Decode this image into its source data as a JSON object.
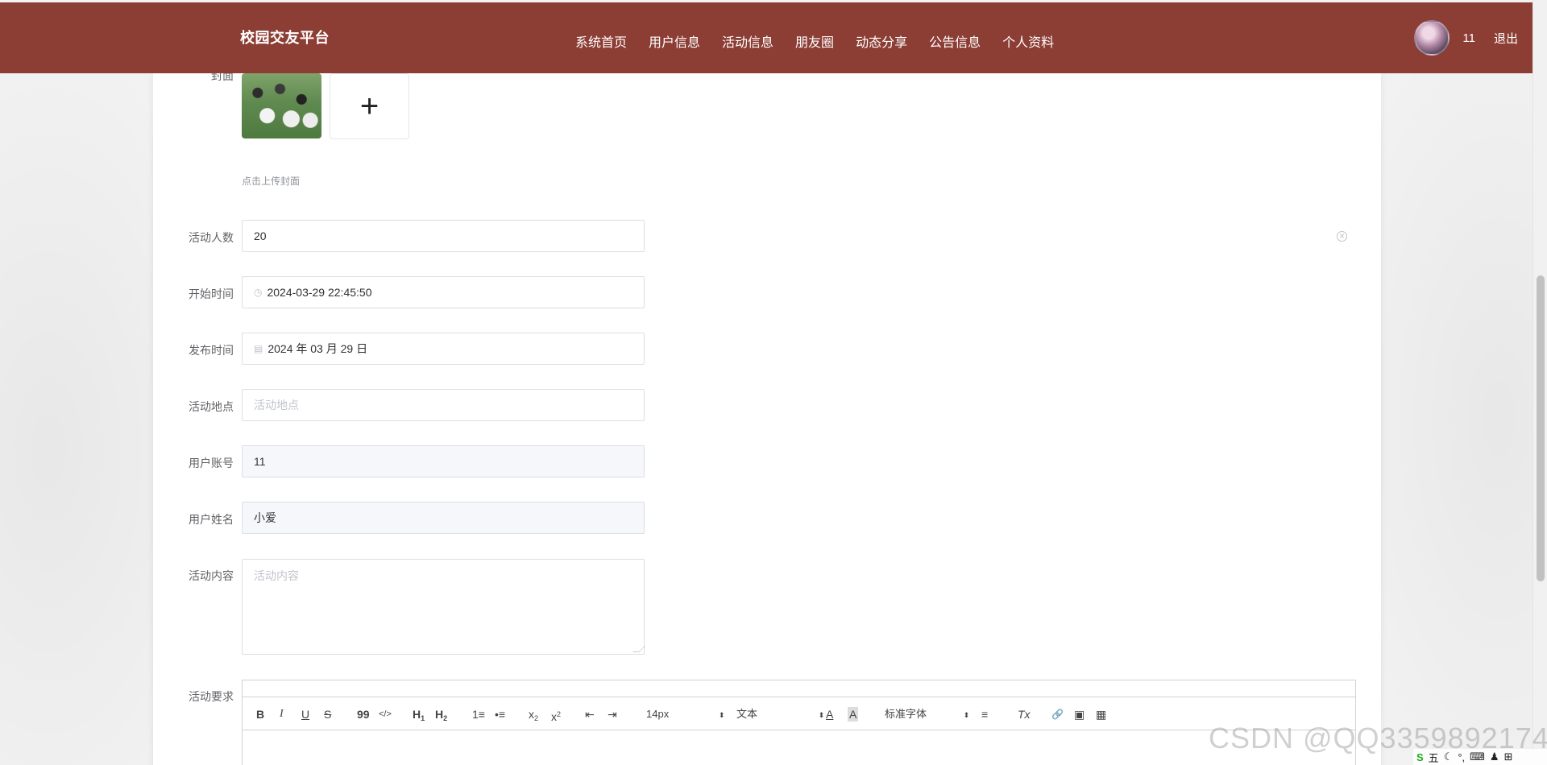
{
  "header": {
    "brand": "校园交友平台",
    "nav": [
      "系统首页",
      "用户信息",
      "活动信息",
      "朋友圈",
      "动态分享",
      "公告信息",
      "个人资料"
    ],
    "user_name": "11",
    "logout": "退出"
  },
  "form": {
    "cover": {
      "label": "封面",
      "upload_plus": "+",
      "tip": "点击上传封面"
    },
    "participants": {
      "label": "活动人数",
      "value": "20"
    },
    "start_time": {
      "label": "开始时间",
      "value": "2024-03-29 22:45:50",
      "icon": "clock-icon"
    },
    "publish_time": {
      "label": "发布时间",
      "value": "2024 年 03 月 29 日",
      "icon": "calendar-icon"
    },
    "location": {
      "label": "活动地点",
      "placeholder": "活动地点"
    },
    "account": {
      "label": "用户账号",
      "value": "11"
    },
    "user_fullname": {
      "label": "用户姓名",
      "value": "小爱"
    },
    "content": {
      "label": "活动内容",
      "placeholder": "活动内容"
    },
    "requirements": {
      "label": "活动要求"
    }
  },
  "editor": {
    "toolbar": {
      "bold": "B",
      "italic": "I",
      "underline": "U",
      "strike": "S",
      "quote": "99",
      "code": "</>",
      "h1": "H1",
      "h2": "H2",
      "ordered_list": "1≡",
      "bullet_list": "•≡",
      "subscript": "x2",
      "superscript": "x2",
      "outdent": "⇤",
      "indent": "⇥",
      "font_size": "14px",
      "header_type": "文本",
      "font_color": "A",
      "background": "A",
      "font_family": "标准字体",
      "align": "≡",
      "clean": "Tx",
      "link": "🔗",
      "image": "▣",
      "video": "▦"
    }
  },
  "watermark": "CSDN @QQ3359892174",
  "tray": {
    "ime": "五"
  },
  "colors": {
    "header_bg": "#8c3d34",
    "card_bg": "#ffffff",
    "page_bg": "#f4f4f4"
  }
}
